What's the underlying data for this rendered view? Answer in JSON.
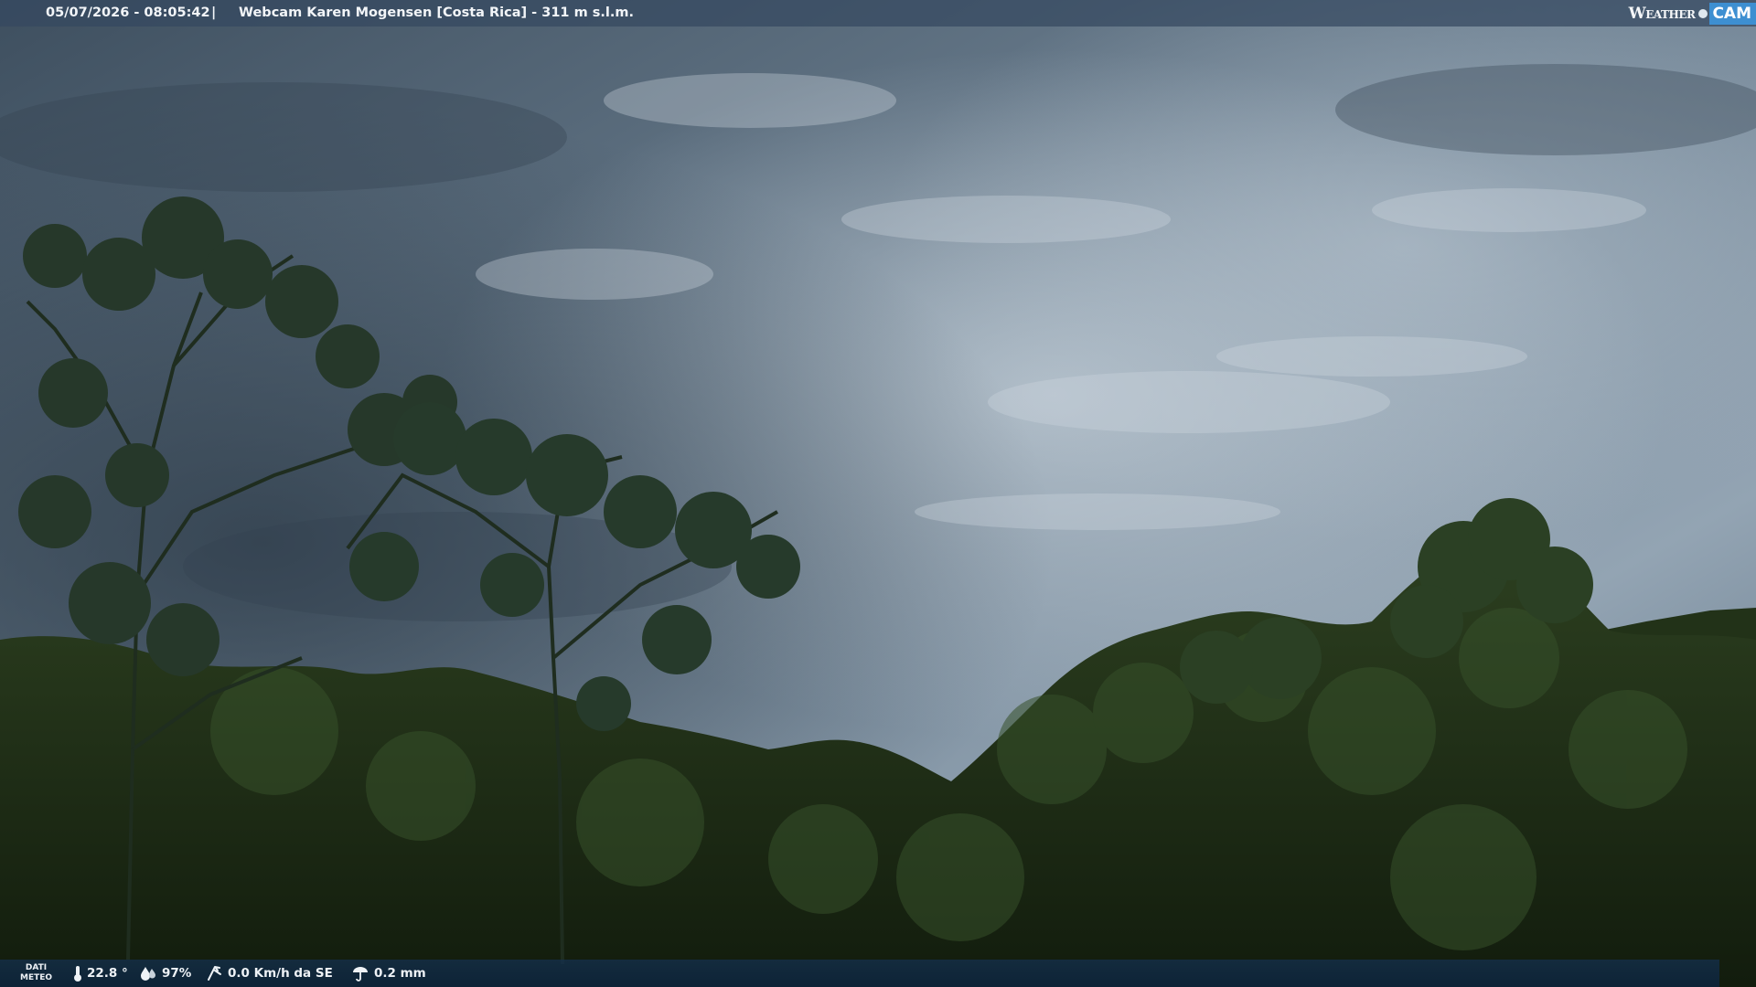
{
  "header": {
    "datetime": "05/07/2026 - 08:05:42",
    "separator": "|",
    "title": "Webcam Karen Mogensen [Costa Rica]  - 311 m s.l.m.",
    "brand_word": "Weather",
    "brand_cam": "CAM"
  },
  "footer": {
    "dati_line1": "DATI",
    "dati_line2": "METEO",
    "temperature": "22.8 °",
    "humidity": "97%",
    "wind": "0.0 Km/h da SE",
    "rain": "0.2 mm"
  },
  "icons": [
    "thermometer-icon",
    "humidity-icon",
    "wind-icon",
    "rain-icon"
  ],
  "colors": {
    "sky_dark": "#3a4b5a",
    "sky_light": "#b9c5cf",
    "forest": "#1c2b14",
    "brand_blue": "#3d8fd1"
  }
}
